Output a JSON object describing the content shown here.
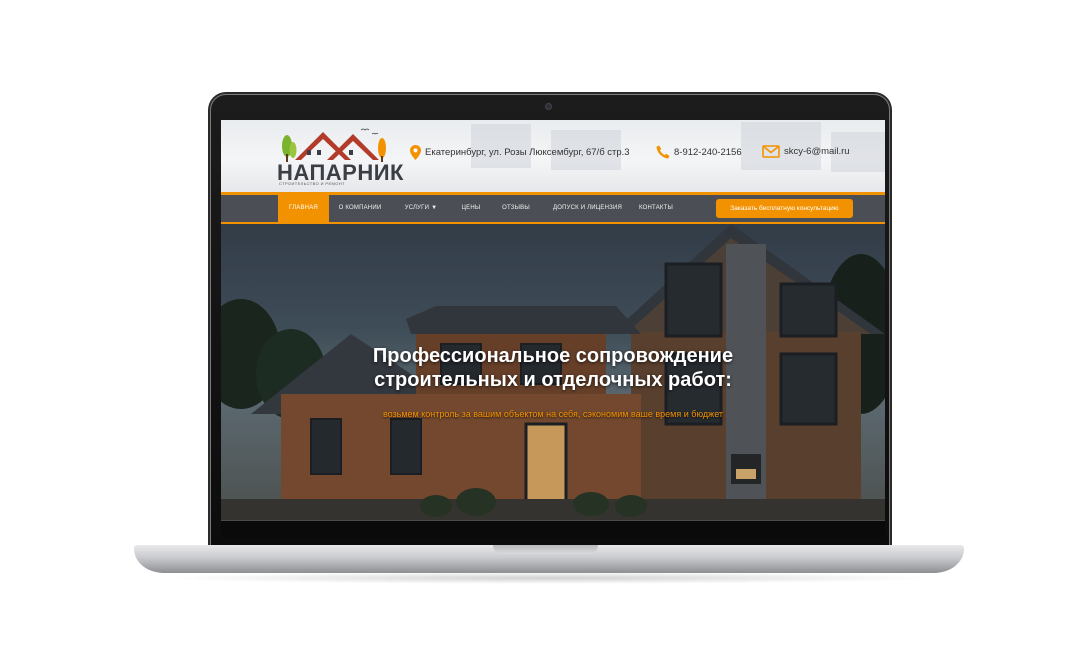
{
  "brand": {
    "name": "НАПАРНИК",
    "tagline": "СТРОИТЕЛЬСТВО И РЕМОНТ"
  },
  "contacts": {
    "address": "Екатеринбург, ул. Розы Люксембург, 67/б стр.3",
    "phone": "8-912-240-2156",
    "email": "skcy-6@mail.ru"
  },
  "nav": {
    "items": [
      {
        "label": "Главная"
      },
      {
        "label": "О компании"
      },
      {
        "label": "Услуги"
      },
      {
        "label": "Цены"
      },
      {
        "label": "Отзывы"
      },
      {
        "label": "Допуск и Лицензия"
      },
      {
        "label": "Контакты"
      }
    ],
    "cta": "Заказать бесплатную консультацию"
  },
  "hero": {
    "title_line1": "Профессиональное сопровождение",
    "title_line2": "строительных и отделочных работ:",
    "subtitle": "возьмем контроль за вашим объектом на себя, сэкономим ваше время и бюджет"
  },
  "colors": {
    "accent": "#f39200",
    "nav_bg": "#4b4f55"
  },
  "icons": {
    "address": "map-pin-icon",
    "phone": "phone-icon",
    "email": "envelope-icon",
    "dropdown": "chevron-down-icon"
  }
}
